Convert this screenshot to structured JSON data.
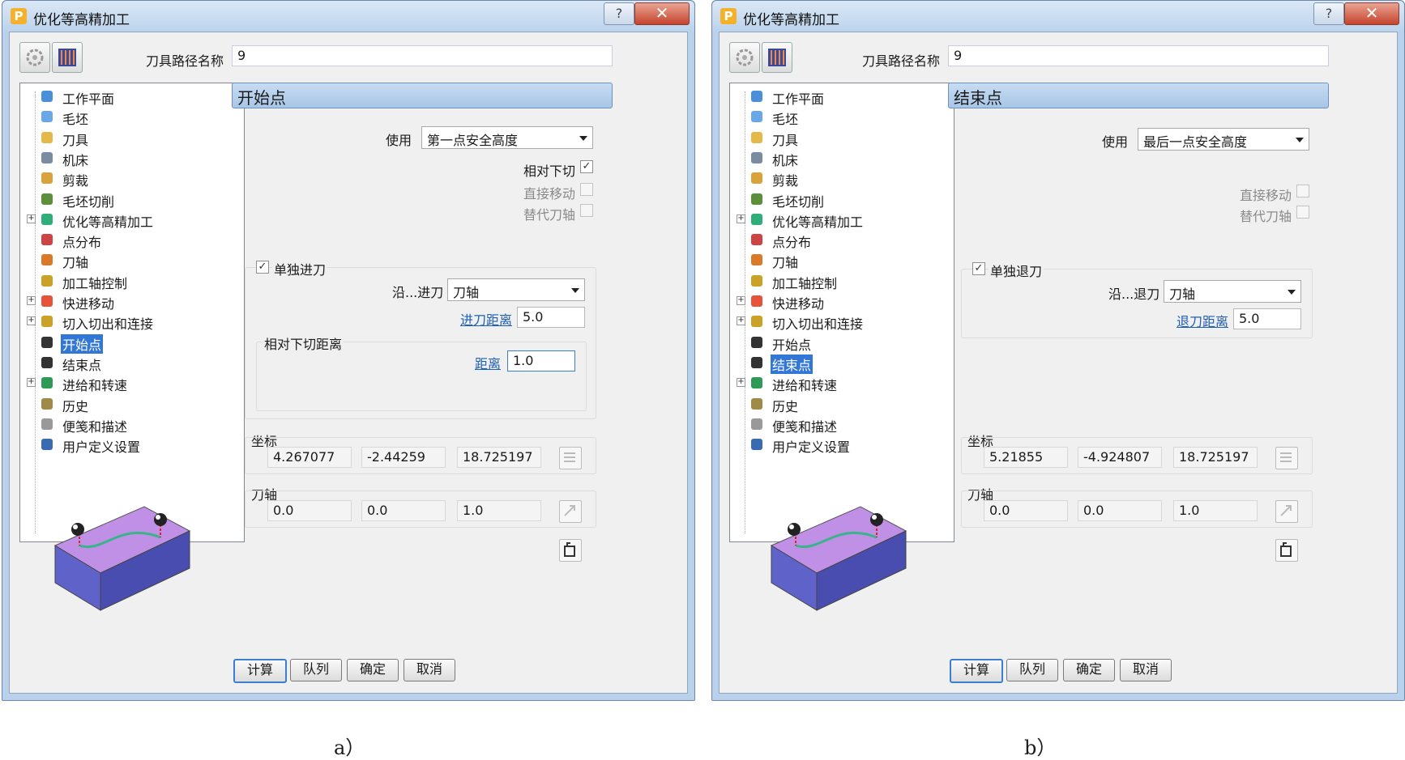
{
  "dialogs": [
    {
      "title": "优化等高精加工",
      "toolpath_name_label": "刀具路径名称",
      "toolpath_name": "9",
      "tree_items": [
        {
          "label": "工作平面",
          "expandable": false
        },
        {
          "label": "毛坯",
          "expandable": false
        },
        {
          "label": "刀具",
          "expandable": false
        },
        {
          "label": "机床",
          "expandable": false
        },
        {
          "label": "剪裁",
          "expandable": false
        },
        {
          "label": "毛坯切削",
          "expandable": false
        },
        {
          "label": "优化等高精加工",
          "expandable": true
        },
        {
          "label": "点分布",
          "expandable": false
        },
        {
          "label": "刀轴",
          "expandable": false
        },
        {
          "label": "加工轴控制",
          "expandable": false
        },
        {
          "label": "快进移动",
          "expandable": true
        },
        {
          "label": "切入切出和连接",
          "expandable": true
        },
        {
          "label": "开始点",
          "expandable": false
        },
        {
          "label": "结束点",
          "expandable": false
        },
        {
          "label": "进给和转速",
          "expandable": true
        },
        {
          "label": "历史",
          "expandable": false
        },
        {
          "label": "便笺和描述",
          "expandable": false
        },
        {
          "label": "用户定义设置",
          "expandable": false
        }
      ],
      "selected_index": 12,
      "section_title": "开始点",
      "use_label": "使用",
      "use_value": "第一点安全高度",
      "relative_plunge_label": "相对下切",
      "relative_plunge_checked": true,
      "direct_move_label": "直接移动",
      "alt_axis_label": "替代刀轴",
      "separate_label": "单独进刀",
      "along_label": "沿...进刀",
      "along_value": "刀轴",
      "distance_link": "进刀距离",
      "distance_value": "5.0",
      "plunge_group_label": "相对下切距离",
      "plunge_dist_link": "距离",
      "plunge_dist_value": "1.0",
      "coords_label": "坐标",
      "coords": [
        "4.267077",
        "-2.44259",
        "18.725197"
      ],
      "axis_label": "刀轴",
      "axis": [
        "0.0",
        "0.0",
        "1.0"
      ],
      "buttons": {
        "calc": "计算",
        "queue": "队列",
        "ok": "确定",
        "cancel": "取消"
      },
      "caption": "a）"
    },
    {
      "title": "优化等高精加工",
      "toolpath_name_label": "刀具路径名称",
      "toolpath_name": "9",
      "tree_items": [
        {
          "label": "工作平面",
          "expandable": false
        },
        {
          "label": "毛坯",
          "expandable": false
        },
        {
          "label": "刀具",
          "expandable": false
        },
        {
          "label": "机床",
          "expandable": false
        },
        {
          "label": "剪裁",
          "expandable": false
        },
        {
          "label": "毛坯切削",
          "expandable": false
        },
        {
          "label": "优化等高精加工",
          "expandable": true
        },
        {
          "label": "点分布",
          "expandable": false
        },
        {
          "label": "刀轴",
          "expandable": false
        },
        {
          "label": "加工轴控制",
          "expandable": false
        },
        {
          "label": "快进移动",
          "expandable": true
        },
        {
          "label": "切入切出和连接",
          "expandable": true
        },
        {
          "label": "开始点",
          "expandable": false
        },
        {
          "label": "结束点",
          "expandable": false
        },
        {
          "label": "进给和转速",
          "expandable": true
        },
        {
          "label": "历史",
          "expandable": false
        },
        {
          "label": "便笺和描述",
          "expandable": false
        },
        {
          "label": "用户定义设置",
          "expandable": false
        }
      ],
      "selected_index": 13,
      "section_title": "结束点",
      "use_label": "使用",
      "use_value": "最后一点安全高度",
      "direct_move_label": "直接移动",
      "alt_axis_label": "替代刀轴",
      "separate_label": "单独退刀",
      "along_label": "沿...退刀",
      "along_value": "刀轴",
      "distance_link": "退刀距离",
      "distance_value": "5.0",
      "coords_label": "坐标",
      "coords": [
        "5.21855",
        "-4.924807",
        "18.725197"
      ],
      "axis_label": "刀轴",
      "axis": [
        "0.0",
        "0.0",
        "1.0"
      ],
      "buttons": {
        "calc": "计算",
        "queue": "队列",
        "ok": "确定",
        "cancel": "取消"
      },
      "caption": "b）"
    }
  ],
  "colors": {
    "selection": "#3377d6",
    "block_top": "#c08fe6",
    "block_front": "#5f63c9",
    "block_side": "#4a4db0",
    "toolpath": "#39b38a"
  }
}
